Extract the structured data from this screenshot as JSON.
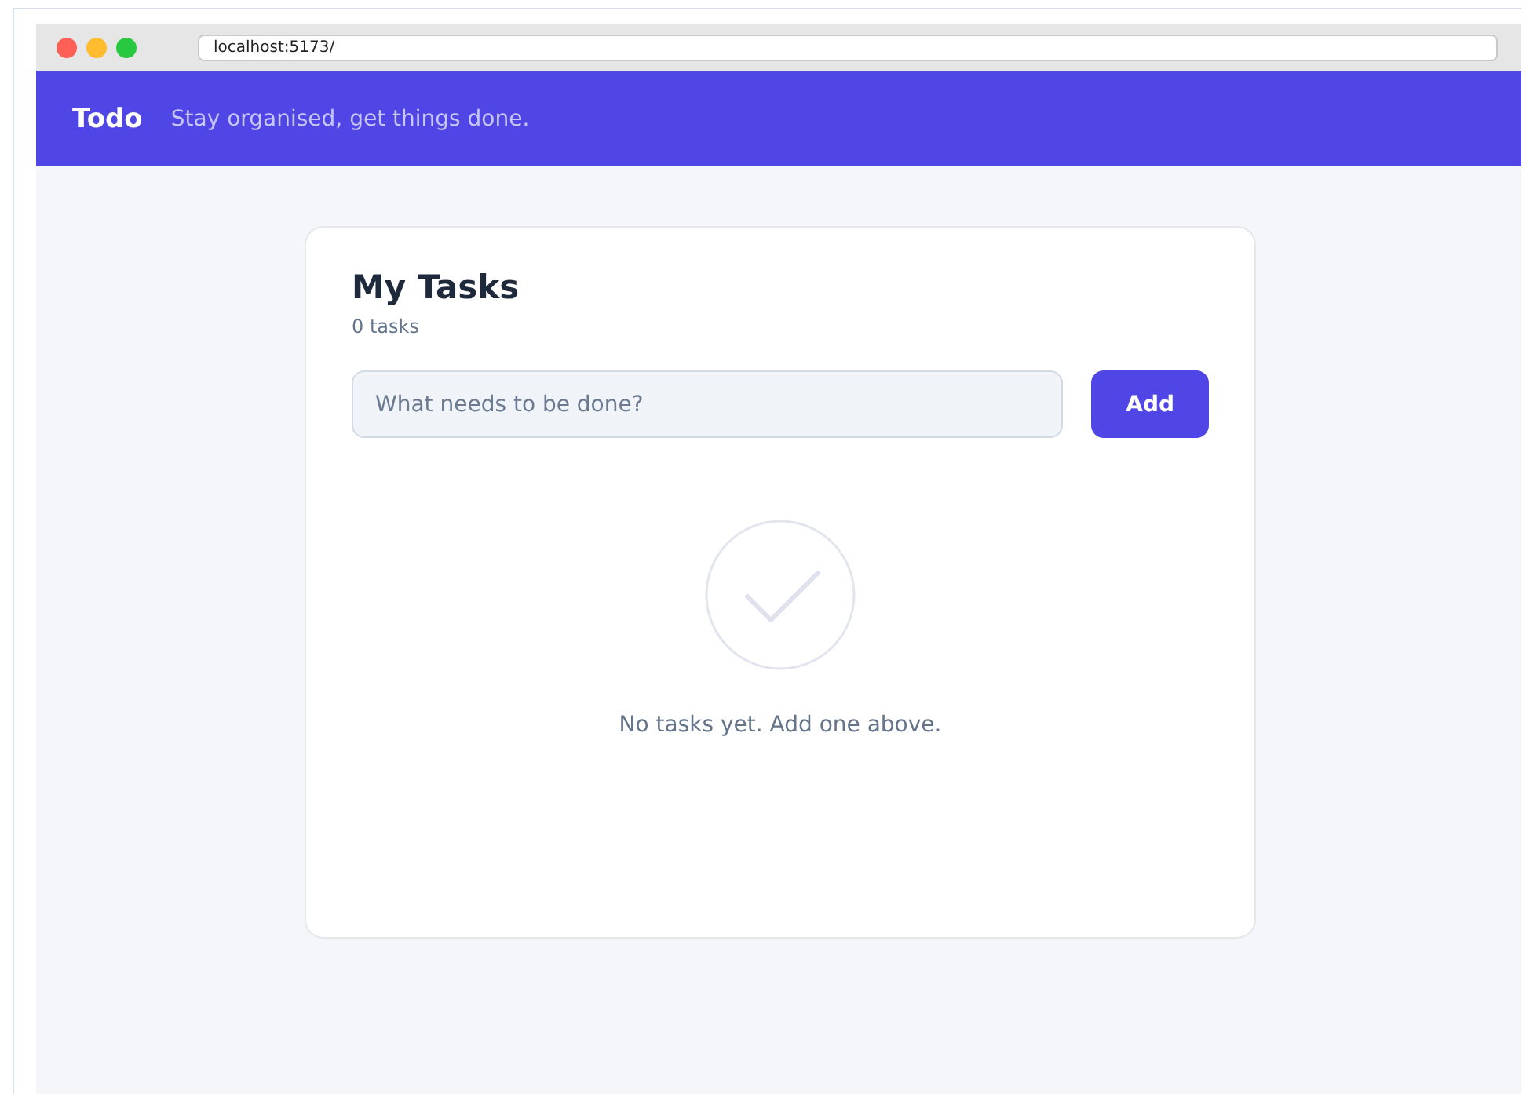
{
  "browser": {
    "url": "localhost:5173/"
  },
  "header": {
    "brand": "Todo",
    "tagline": "Stay organised, get things done."
  },
  "card": {
    "title": "My Tasks",
    "count": "0 tasks",
    "input": {
      "placeholder": "What needs to be done?"
    },
    "add_button": "Add",
    "empty_message": "No tasks yet. Add one above."
  }
}
